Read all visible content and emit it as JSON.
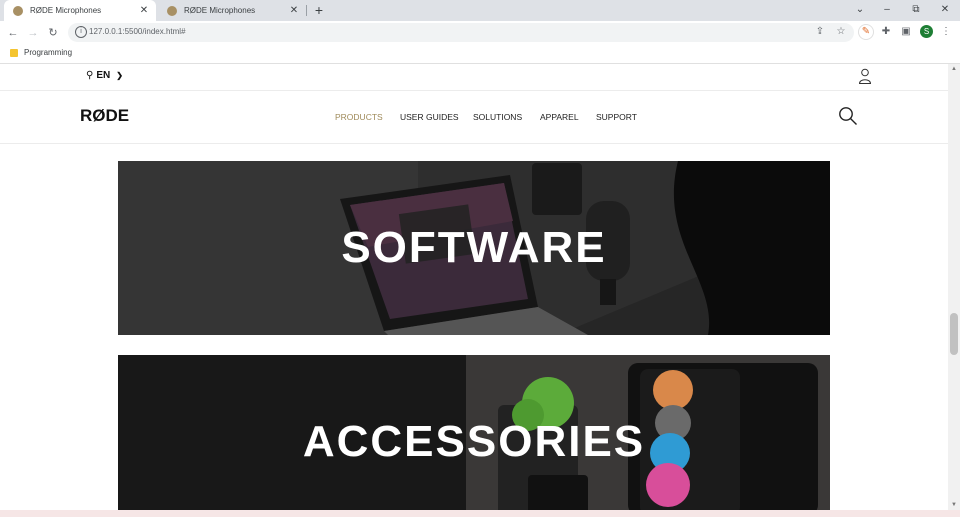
{
  "browser": {
    "tabs": [
      {
        "title": "RØDE Microphones",
        "active": true
      },
      {
        "title": "RØDE Microphones",
        "active": false
      }
    ],
    "new_tab": "+",
    "window_controls": {
      "minimize": "–",
      "restore": "⧉",
      "close": "✕",
      "tab_search": "⌄"
    },
    "address": "127.0.0.1:5500/index.html#",
    "profile_initial": "S",
    "bookmarks": [
      {
        "label": "Programming"
      }
    ]
  },
  "site": {
    "language": "EN",
    "logo": "RØDE",
    "nav": [
      {
        "label": "PRODUCTS",
        "active": true
      },
      {
        "label": "USER GUIDES",
        "active": false
      },
      {
        "label": "SOLUTIONS",
        "active": false
      },
      {
        "label": "APPAREL",
        "active": false
      },
      {
        "label": "SUPPORT",
        "active": false
      }
    ],
    "tiles": [
      {
        "label": "SOFTWARE"
      },
      {
        "label": "ACCESSORIES"
      }
    ],
    "colors": {
      "accent": "#a08b5b"
    }
  }
}
